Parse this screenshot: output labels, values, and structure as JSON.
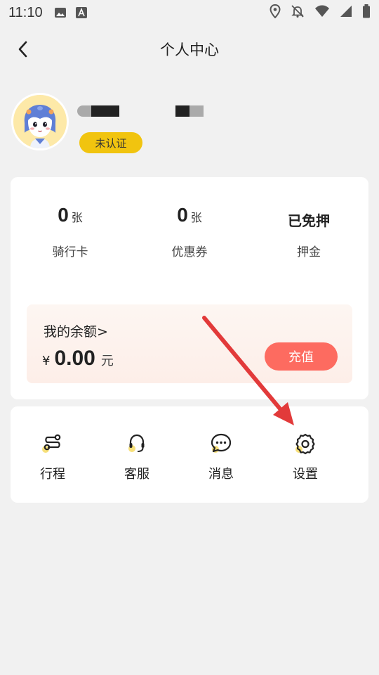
{
  "status_bar": {
    "time": "11:10",
    "icons": [
      "image-icon",
      "font-icon",
      "location-icon",
      "bell-off-icon",
      "wifi-icon",
      "signal-icon",
      "battery-icon"
    ]
  },
  "header": {
    "back_icon": "chevron-left-icon",
    "title": "个人中心"
  },
  "profile": {
    "avatar": "avatar",
    "badge": "未认证"
  },
  "stats": [
    {
      "value": "0",
      "unit": "张",
      "label": "骑行卡"
    },
    {
      "value": "0",
      "unit": "张",
      "label": "优惠券"
    },
    {
      "value": "已免押",
      "label": "押金"
    }
  ],
  "balance": {
    "title": "我的余额>",
    "currency": "¥",
    "amount": "0.00",
    "unit": "元",
    "recharge_label": "充值"
  },
  "tools": [
    {
      "icon": "route-icon",
      "label": "行程"
    },
    {
      "icon": "headset-icon",
      "label": "客服"
    },
    {
      "icon": "chat-icon",
      "label": "消息"
    },
    {
      "icon": "gear-icon",
      "label": "设置"
    }
  ],
  "colors": {
    "background": "#f1f1f1",
    "badge": "#f1c40f",
    "recharge": "#fd6b60",
    "annotation_arrow": "#e23a3a",
    "icon_accent": "#f7e07a"
  }
}
